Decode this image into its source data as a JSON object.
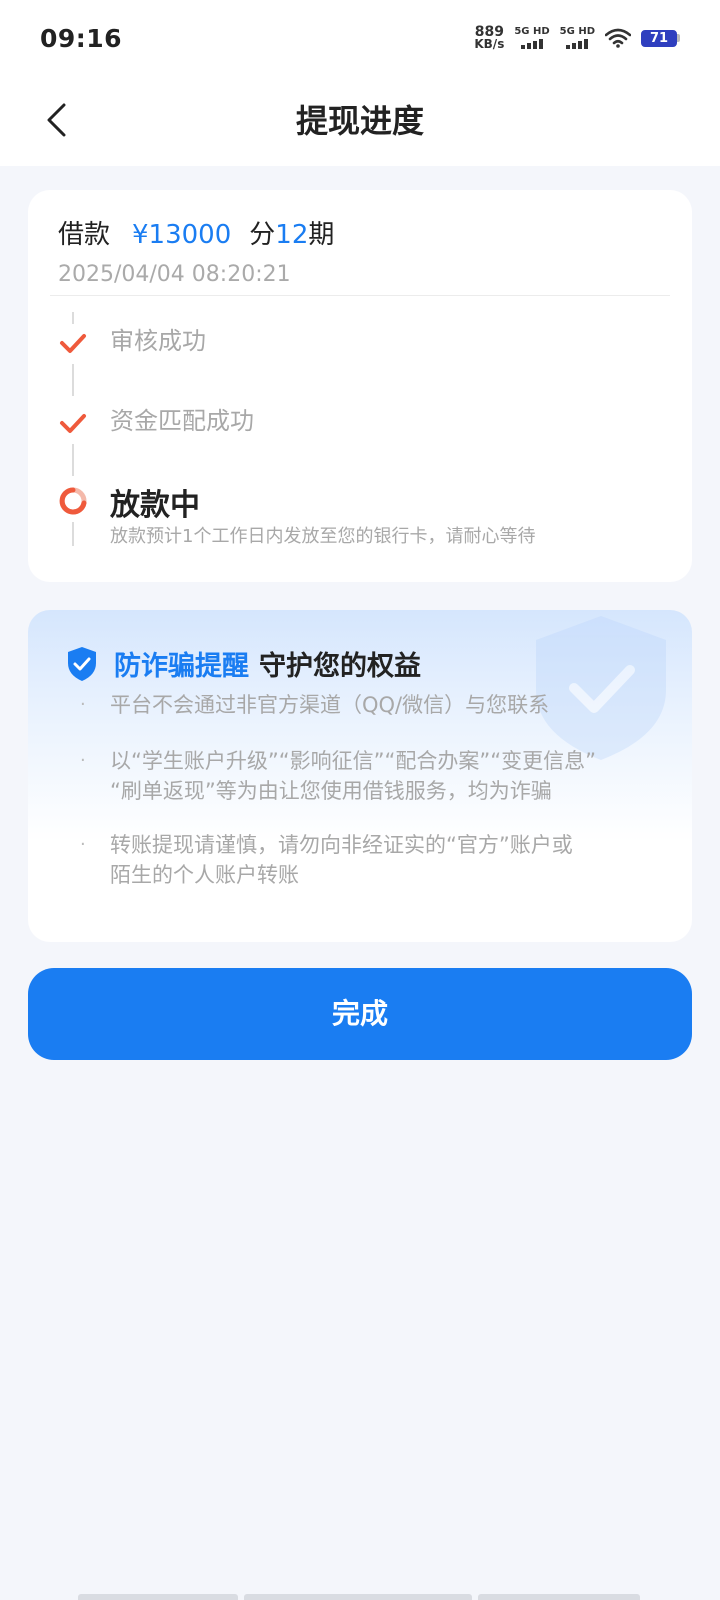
{
  "status_bar": {
    "time": "09:16",
    "net_speed_value": "889",
    "net_speed_unit": "KB/s",
    "sim1_label": "5G HD",
    "sim2_label": "5G HD",
    "battery_level": "71"
  },
  "header": {
    "title": "提现进度"
  },
  "loan": {
    "prefix": "借款",
    "amount": "¥13000",
    "term_prefix": "分",
    "term_count": "12",
    "term_suffix": "期",
    "datetime": "2025/04/04 08:20:21"
  },
  "steps": [
    {
      "label": "审核成功",
      "status": "done"
    },
    {
      "label": "资金匹配成功",
      "status": "done"
    },
    {
      "label": "放款中",
      "status": "in_progress",
      "description": "放款预计1个工作日内发放至您的银行卡，请耐心等待"
    }
  ],
  "fraud_notice": {
    "title_highlight": "防诈骗提醒",
    "title_rest": "守护您的权益",
    "bullet": "·",
    "items": [
      {
        "line1": "平台不会通过非官方渠道（QQ/微信）与您联系",
        "line2": ""
      },
      {
        "line1": "以“学生账户升级”“影响征信”“配合办案”“变更信息”",
        "line2": "“刷单返现”等为由让您使用借钱服务，均为诈骗"
      },
      {
        "line1": "转账提现请谨慎，请勿向非经证实的“官方”账户或",
        "line2": "陌生的个人账户转账"
      }
    ]
  },
  "actions": {
    "done_label": "完成"
  },
  "colors": {
    "accent": "#1a7df2",
    "check": "#ef5a3c",
    "background": "#f4f6fb"
  }
}
